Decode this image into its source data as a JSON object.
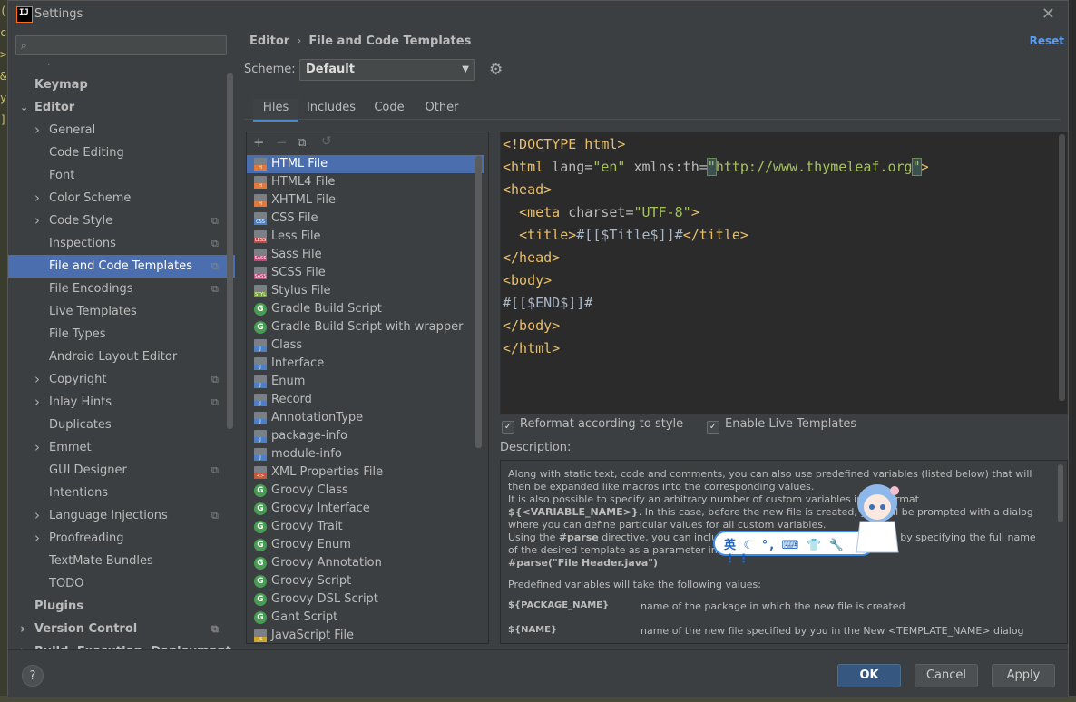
{
  "window": {
    "title": "Settings",
    "app_icon_text": "IJ"
  },
  "search": {
    "placeholder": "",
    "value": ""
  },
  "sidebar": {
    "items": [
      {
        "label": "Keymap",
        "level": 0,
        "bold": true,
        "arrow": "",
        "config": false
      },
      {
        "label": "Editor",
        "level": 0,
        "bold": true,
        "arrow": "down",
        "config": false
      },
      {
        "label": "General",
        "level": 1,
        "arrow": "right",
        "config": false
      },
      {
        "label": "Code Editing",
        "level": 1,
        "arrow": "",
        "config": false
      },
      {
        "label": "Font",
        "level": 1,
        "arrow": "",
        "config": false
      },
      {
        "label": "Color Scheme",
        "level": 1,
        "arrow": "right",
        "config": false
      },
      {
        "label": "Code Style",
        "level": 1,
        "arrow": "right",
        "config": true
      },
      {
        "label": "Inspections",
        "level": 1,
        "arrow": "",
        "config": true
      },
      {
        "label": "File and Code Templates",
        "level": 1,
        "arrow": "",
        "config": true,
        "selected": true
      },
      {
        "label": "File Encodings",
        "level": 1,
        "arrow": "",
        "config": true
      },
      {
        "label": "Live Templates",
        "level": 1,
        "arrow": "",
        "config": false
      },
      {
        "label": "File Types",
        "level": 1,
        "arrow": "",
        "config": false
      },
      {
        "label": "Android Layout Editor",
        "level": 1,
        "arrow": "",
        "config": false
      },
      {
        "label": "Copyright",
        "level": 1,
        "arrow": "right",
        "config": true
      },
      {
        "label": "Inlay Hints",
        "level": 1,
        "arrow": "right",
        "config": true
      },
      {
        "label": "Duplicates",
        "level": 1,
        "arrow": "",
        "config": false
      },
      {
        "label": "Emmet",
        "level": 1,
        "arrow": "right",
        "config": false
      },
      {
        "label": "GUI Designer",
        "level": 1,
        "arrow": "",
        "config": true
      },
      {
        "label": "Intentions",
        "level": 1,
        "arrow": "",
        "config": false
      },
      {
        "label": "Language Injections",
        "level": 1,
        "arrow": "right",
        "config": true
      },
      {
        "label": "Proofreading",
        "level": 1,
        "arrow": "right",
        "config": false
      },
      {
        "label": "TextMate Bundles",
        "level": 1,
        "arrow": "",
        "config": false
      },
      {
        "label": "TODO",
        "level": 1,
        "arrow": "",
        "config": false
      },
      {
        "label": "Plugins",
        "level": 0,
        "bold": true,
        "arrow": "",
        "config": false
      },
      {
        "label": "Version Control",
        "level": 0,
        "bold": true,
        "arrow": "right",
        "config": true
      },
      {
        "label": "Build, Execution, Deployment",
        "level": 0,
        "bold": true,
        "arrow": "right",
        "config": false
      }
    ]
  },
  "breadcrumb": {
    "parent": "Editor",
    "separator": "›",
    "current": "File and Code Templates"
  },
  "reset_label": "Reset",
  "scheme": {
    "label": "Scheme:",
    "value": "Default"
  },
  "tabs": [
    "Files",
    "Includes",
    "Code",
    "Other"
  ],
  "active_tab": "Files",
  "file_templates": [
    {
      "label": "HTML File",
      "icon": "html",
      "tag": "H",
      "selected": true
    },
    {
      "label": "HTML4 File",
      "icon": "html",
      "tag": "H"
    },
    {
      "label": "XHTML File",
      "icon": "xhtml",
      "tag": "H"
    },
    {
      "label": "CSS File",
      "icon": "css",
      "tag": "CSS"
    },
    {
      "label": "Less File",
      "icon": "less",
      "tag": "LESS"
    },
    {
      "label": "Sass File",
      "icon": "sass",
      "tag": "SASS"
    },
    {
      "label": "SCSS File",
      "icon": "scss",
      "tag": "SASS"
    },
    {
      "label": "Stylus File",
      "icon": "stylus",
      "tag": "STYL"
    },
    {
      "label": "Gradle Build Script",
      "icon": "gradle",
      "tag": "G"
    },
    {
      "label": "Gradle Build Script with wrapper",
      "icon": "gradle",
      "tag": "G"
    },
    {
      "label": "Class",
      "icon": "java",
      "tag": "J"
    },
    {
      "label": "Interface",
      "icon": "java",
      "tag": "J"
    },
    {
      "label": "Enum",
      "icon": "java",
      "tag": "J"
    },
    {
      "label": "Record",
      "icon": "java",
      "tag": "J"
    },
    {
      "label": "AnnotationType",
      "icon": "java",
      "tag": "J"
    },
    {
      "label": "package-info",
      "icon": "java",
      "tag": "J"
    },
    {
      "label": "module-info",
      "icon": "java",
      "tag": "J"
    },
    {
      "label": "XML Properties File",
      "icon": "xml",
      "tag": "<>"
    },
    {
      "label": "Groovy Class",
      "icon": "groovy",
      "tag": "G"
    },
    {
      "label": "Groovy Interface",
      "icon": "groovy",
      "tag": "G"
    },
    {
      "label": "Groovy Trait",
      "icon": "groovy",
      "tag": "G"
    },
    {
      "label": "Groovy Enum",
      "icon": "groovy",
      "tag": "G"
    },
    {
      "label": "Groovy Annotation",
      "icon": "groovy",
      "tag": "G"
    },
    {
      "label": "Groovy Script",
      "icon": "groovy",
      "tag": "G"
    },
    {
      "label": "Groovy DSL Script",
      "icon": "groovy",
      "tag": "G"
    },
    {
      "label": "Gant Script",
      "icon": "groovy",
      "tag": "G"
    },
    {
      "label": "JavaScript File",
      "icon": "js",
      "tag": "JS"
    }
  ],
  "code_lines": [
    [
      [
        "tg",
        "<!DOCTYPE html>"
      ]
    ],
    [
      [
        "tg",
        "<html "
      ],
      [
        "at",
        "lang="
      ],
      [
        "st",
        "\"en\""
      ],
      [
        "at",
        " xmlns:th="
      ],
      [
        "caret",
        "\""
      ],
      [
        "st",
        "http://www.thymeleaf.org"
      ],
      [
        "caret",
        "\""
      ],
      [
        "tg",
        ">"
      ]
    ],
    [
      [
        "tg",
        "<head>"
      ]
    ],
    [
      [
        "tx",
        "  "
      ],
      [
        "tg",
        "<meta "
      ],
      [
        "at",
        "charset="
      ],
      [
        "st",
        "\"UTF-8\""
      ],
      [
        "tg",
        ">"
      ]
    ],
    [
      [
        "tx",
        "  "
      ],
      [
        "tg",
        "<title>"
      ],
      [
        "tx",
        "#[[$Title$]]#"
      ],
      [
        "tg",
        "</title>"
      ]
    ],
    [
      [
        "tg",
        "</head>"
      ]
    ],
    [
      [
        "tg",
        "<body>"
      ]
    ],
    [
      [
        "tx",
        "#[[$END$]]#"
      ]
    ],
    [
      [
        "tg",
        "</body>"
      ]
    ],
    [
      [
        "tg",
        "</html>"
      ]
    ]
  ],
  "options": {
    "reformat": {
      "label": "Reformat according to style",
      "checked": true
    },
    "live_templates": {
      "label": "Enable Live Templates",
      "checked": true
    }
  },
  "description": {
    "label": "Description:",
    "p1": "Along with static text, code and comments, you can also use predefined variables (listed below) that will then be expanded like macros into the corresponding values.",
    "p2a": "It is also possible to specify an arbitrary number of custom variables in the format",
    "p2b": "${<VARIABLE_NAME>}",
    "p2c": ". In this case, before the new file is created, you will be prompted with a dialog where you can define particular values for all custom variables.",
    "p3a": "Using the",
    "p3b": "#parse",
    "p3c": "directive, you can include templates from the Includes tab, by specifying the full name of the desired template as a parameter in quotes. For example:",
    "p3d": "#parse(\"File Header.java\")",
    "p4": "Predefined variables will take the following values:",
    "vars": [
      {
        "name": "${PACKAGE_NAME}",
        "desc": "name of the package in which the new file is created"
      },
      {
        "name": "${NAME}",
        "desc": "name of the new file specified by you in the New <TEMPLATE_NAME> dialog"
      }
    ]
  },
  "ime": {
    "text": "英 ☾ °, ⌨ 👕 🔧 ⋮⋮"
  },
  "buttons": {
    "help": "?",
    "ok": "OK",
    "cancel": "Cancel",
    "apply": "Apply"
  },
  "colors": {
    "accent": "#4b6eaf",
    "link": "#589df6",
    "bg": "#3c3f41",
    "editor_bg": "#2b2b2b"
  }
}
